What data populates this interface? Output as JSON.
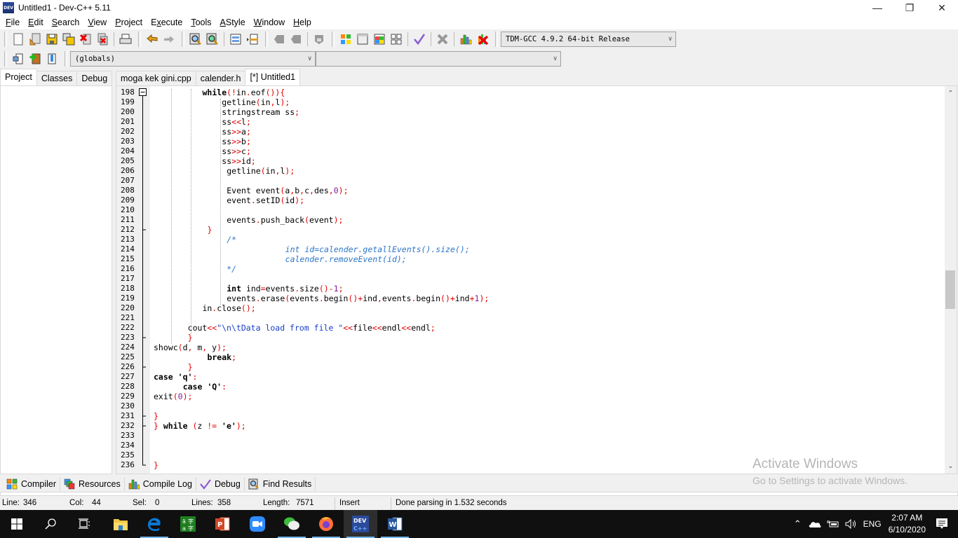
{
  "window": {
    "title": "Untitled1 - Dev-C++ 5.11",
    "app_icon_label": "DEV",
    "controls": {
      "minimize": "—",
      "maximize": "❐",
      "close": "✕"
    }
  },
  "menu": [
    {
      "label": "File",
      "accel": "F",
      "rest": "ile"
    },
    {
      "label": "Edit",
      "accel": "E",
      "rest": "dit"
    },
    {
      "label": "Search",
      "accel": "S",
      "rest": "earch"
    },
    {
      "label": "View",
      "accel": "V",
      "rest": "iew"
    },
    {
      "label": "Project",
      "accel": "P",
      "rest": "roject"
    },
    {
      "label": "Execute",
      "pre": "E",
      "accel": "x",
      "rest": "ecute"
    },
    {
      "label": "Tools",
      "accel": "T",
      "rest": "ools"
    },
    {
      "label": "AStyle",
      "accel": "A",
      "rest": "Style"
    },
    {
      "label": "Window",
      "accel": "W",
      "rest": "indow"
    },
    {
      "label": "Help",
      "accel": "H",
      "rest": "elp"
    }
  ],
  "toolbar": {
    "compiler_select": "TDM-GCC 4.9.2 64-bit Release",
    "globals_select": "(globals)",
    "function_select": ""
  },
  "side_tabs": [
    "Project",
    "Classes",
    "Debug"
  ],
  "editor_tabs": [
    {
      "label": "moga kek gini.cpp",
      "active": false
    },
    {
      "label": "calender.h",
      "active": false
    },
    {
      "label": "[*] Untitled1",
      "active": true
    }
  ],
  "code_lines": [
    {
      "n": "198",
      "fold": "minus",
      "html": "<span class=\"k\">while</span><span class=\"p\">(!</span>in<span class=\"p\">.</span>eof<span class=\"p\">()){</span>",
      "indent": 10
    },
    {
      "n": "199",
      "fold": "line",
      "html": "getline<span class=\"p\">(</span>in<span class=\"p\">,</span>l<span class=\"p\">);</span>",
      "indent": 14
    },
    {
      "n": "200",
      "fold": "line",
      "html": "stringstream ss<span class=\"p\">;</span>",
      "indent": 14
    },
    {
      "n": "201",
      "fold": "line",
      "html": "ss<span class=\"p\">&lt;&lt;</span>l<span class=\"p\">;</span>",
      "indent": 14
    },
    {
      "n": "202",
      "fold": "line",
      "html": "ss<span class=\"p\">&gt;&gt;</span>a<span class=\"p\">;</span>",
      "indent": 14
    },
    {
      "n": "203",
      "fold": "line",
      "html": "ss<span class=\"p\">&gt;&gt;</span>b<span class=\"p\">;</span>",
      "indent": 14
    },
    {
      "n": "204",
      "fold": "line",
      "html": "ss<span class=\"p\">&gt;&gt;</span>c<span class=\"p\">;</span>",
      "indent": 14
    },
    {
      "n": "205",
      "fold": "line",
      "html": "ss<span class=\"p\">&gt;&gt;</span>id<span class=\"p\">;</span>",
      "indent": 14
    },
    {
      "n": "206",
      "fold": "line",
      "html": "getline<span class=\"p\">(</span>in<span class=\"p\">,</span>l<span class=\"p\">);</span>",
      "indent": 15
    },
    {
      "n": "207",
      "fold": "line",
      "html": "",
      "indent": 0
    },
    {
      "n": "208",
      "fold": "line",
      "html": "Event event<span class=\"p\">(</span>a<span class=\"p\">,</span>b<span class=\"p\">,</span>c<span class=\"p\">,</span>des<span class=\"p\">,</span><span class=\"n\">0</span><span class=\"p\">);</span>",
      "indent": 15
    },
    {
      "n": "209",
      "fold": "line",
      "html": "event<span class=\"p\">.</span>setID<span class=\"p\">(</span>id<span class=\"p\">);</span>",
      "indent": 15
    },
    {
      "n": "210",
      "fold": "line",
      "html": "",
      "indent": 0
    },
    {
      "n": "211",
      "fold": "line",
      "html": "events<span class=\"p\">.</span>push_back<span class=\"p\">(</span>event<span class=\"p\">);</span>",
      "indent": 15
    },
    {
      "n": "212",
      "fold": "end",
      "html": "<span class=\"p\">}</span>",
      "indent": 11
    },
    {
      "n": "213",
      "fold": "line",
      "html": "<span class=\"c\">/*</span>",
      "indent": 15
    },
    {
      "n": "214",
      "fold": "line",
      "html": "<span class=\"c\">int id=calender.getallEvents().size();</span>",
      "indent": 27
    },
    {
      "n": "215",
      "fold": "line",
      "html": "<span class=\"c\">calender.removeEvent(id);</span>",
      "indent": 27
    },
    {
      "n": "216",
      "fold": "line",
      "html": "<span class=\"c\">*/</span>",
      "indent": 15
    },
    {
      "n": "217",
      "fold": "line",
      "html": "",
      "indent": 0
    },
    {
      "n": "218",
      "fold": "line",
      "html": "<span class=\"k\">int</span> ind<span class=\"p\">=</span>events<span class=\"p\">.</span>size<span class=\"p\">()-</span><span class=\"n\">1</span><span class=\"p\">;</span>",
      "indent": 15
    },
    {
      "n": "219",
      "fold": "line",
      "html": "events<span class=\"p\">.</span>erase<span class=\"p\">(</span>events<span class=\"p\">.</span>begin<span class=\"p\">()+</span>ind<span class=\"p\">,</span>events<span class=\"p\">.</span>begin<span class=\"p\">()+</span>ind<span class=\"p\">+</span><span class=\"n\">1</span><span class=\"p\">);</span>",
      "indent": 15
    },
    {
      "n": "220",
      "fold": "line",
      "html": "in<span class=\"p\">.</span>close<span class=\"p\">();</span>",
      "indent": 10
    },
    {
      "n": "221",
      "fold": "line",
      "html": "",
      "indent": 0
    },
    {
      "n": "222",
      "fold": "line",
      "html": "cout<span class=\"p\">&lt;&lt;</span><span class=\"s\">\"\\n\\tData load from file \"</span><span class=\"p\">&lt;&lt;</span>file<span class=\"p\">&lt;&lt;</span>endl<span class=\"p\">&lt;&lt;</span>endl<span class=\"p\">;</span>",
      "indent": 7
    },
    {
      "n": "223",
      "fold": "end",
      "html": "<span class=\"p\">}</span>",
      "indent": 7
    },
    {
      "n": "224",
      "fold": "line",
      "html": "showc<span class=\"p\">(</span>d<span class=\"p\">,</span> m<span class=\"p\">,</span> y<span class=\"p\">);</span>",
      "indent": 0
    },
    {
      "n": "225",
      "fold": "line",
      "html": "<span class=\"k\">break</span><span class=\"p\">;</span>",
      "indent": 11
    },
    {
      "n": "226",
      "fold": "end",
      "html": "<span class=\"p\">}</span>",
      "indent": 7
    },
    {
      "n": "227",
      "fold": "line",
      "html": "<span class=\"k\">case</span> <span class=\"k\">'q'</span><span class=\"p\">:</span>",
      "indent": 0
    },
    {
      "n": "228",
      "fold": "line",
      "html": "<span class=\"k\">case</span> <span class=\"k\">'Q'</span><span class=\"p\">:</span>",
      "indent": 6
    },
    {
      "n": "229",
      "fold": "line",
      "html": "exit<span class=\"p\">(</span><span class=\"n\">0</span><span class=\"p\">);</span>",
      "indent": 0
    },
    {
      "n": "230",
      "fold": "line",
      "html": "",
      "indent": 0
    },
    {
      "n": "231",
      "fold": "end",
      "html": "<span class=\"p\">}</span>",
      "indent": 0
    },
    {
      "n": "232",
      "fold": "end",
      "html": "<span class=\"p\">}</span> <span class=\"k\">while</span> <span class=\"p\">(</span>z <span class=\"p\">!=</span> <span class=\"k\">'e'</span><span class=\"p\">);</span>",
      "indent": 0
    },
    {
      "n": "233",
      "fold": "line",
      "html": "",
      "indent": 0
    },
    {
      "n": "234",
      "fold": "line",
      "html": "",
      "indent": 0
    },
    {
      "n": "235",
      "fold": "line",
      "html": "",
      "indent": 0
    },
    {
      "n": "236",
      "fold": "last",
      "html": "<span class=\"p\">}</span>",
      "indent": 0
    }
  ],
  "scroll_position": 0.53,
  "bottom_tabs": [
    {
      "label": "Compiler",
      "icon": "grid-icon"
    },
    {
      "label": "Resources",
      "icon": "resources-icon"
    },
    {
      "label": "Compile Log",
      "icon": "bar-chart-icon"
    },
    {
      "label": "Debug",
      "icon": "check-icon"
    },
    {
      "label": "Find Results",
      "icon": "find-icon"
    }
  ],
  "status": {
    "line_label": "Line:",
    "line": "346",
    "col_label": "Col:",
    "col": "44",
    "sel_label": "Sel:",
    "sel": "0",
    "lines_label": "Lines:",
    "lines": "358",
    "length_label": "Length:",
    "length": "7571",
    "mode": "Insert",
    "message": "Done parsing in 1.532 seconds"
  },
  "watermark": {
    "title": "Activate Windows",
    "subtitle": "Go to Settings to activate Windows."
  },
  "taskbar": {
    "apps": [
      "start-icon",
      "search-icon",
      "task-view-icon",
      "file-explorer-icon",
      "edge-icon",
      "translator-icon",
      "powerpoint-icon",
      "zoom-icon",
      "wechat-icon",
      "firefox-icon",
      "devcpp-icon",
      "word-icon"
    ],
    "language": "ENG",
    "time": "2:07 AM",
    "date": "6/10/2020"
  },
  "colors": {
    "code_punct": "#e00000",
    "code_number": "#7f1f9f",
    "code_string": "#1a3fc8",
    "code_comment": "#2c76c8",
    "taskbar_bg": "#101010",
    "taskbar_accent": "#76b9ed"
  }
}
